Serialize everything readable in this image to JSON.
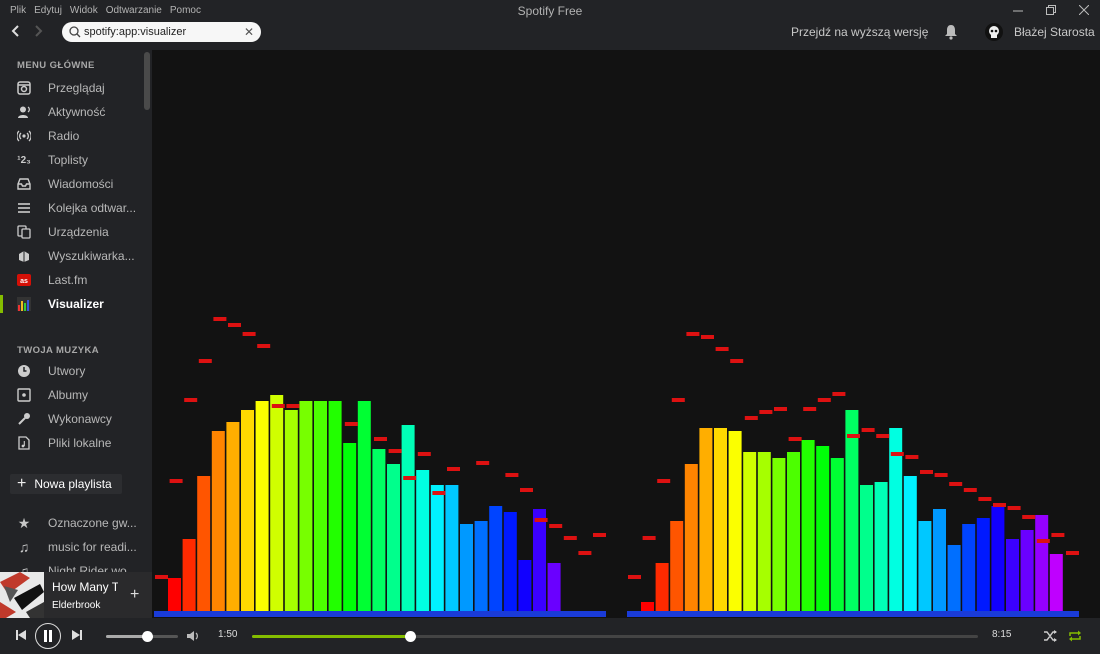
{
  "window": {
    "title": "Spotify Free",
    "menu": [
      "Plik",
      "Edytuj",
      "Widok",
      "Odtwarzanie",
      "Pomoc"
    ]
  },
  "header": {
    "search_value": "spotify:app:visualizer",
    "upgrade_label": "Przejdź na wyższą wersję",
    "username": "Błażej Starosta"
  },
  "sidebar": {
    "main_heading": "MENU GŁÓWNE",
    "main_items": [
      {
        "label": "Przeglądaj",
        "icon": "browse-icon"
      },
      {
        "label": "Aktywność",
        "icon": "activity-icon"
      },
      {
        "label": "Radio",
        "icon": "radio-icon"
      },
      {
        "label": "Toplisty",
        "icon": "charts-icon"
      },
      {
        "label": "Wiadomości",
        "icon": "inbox-icon"
      },
      {
        "label": "Kolejka odtwar...",
        "icon": "queue-icon"
      },
      {
        "label": "Urządzenia",
        "icon": "devices-icon"
      },
      {
        "label": "Wyszukiwarka...",
        "icon": "app-finder-icon"
      },
      {
        "label": "Last.fm",
        "icon": "lastfm-icon"
      },
      {
        "label": "Visualizer",
        "icon": "visualizer-icon",
        "active": true
      }
    ],
    "music_heading": "TWOJA MUZYKA",
    "music_items": [
      {
        "label": "Utwory",
        "icon": "songs-icon"
      },
      {
        "label": "Albumy",
        "icon": "albums-icon"
      },
      {
        "label": "Wykonawcy",
        "icon": "artists-icon"
      },
      {
        "label": "Pliki lokalne",
        "icon": "local-files-icon"
      }
    ],
    "new_playlist_label": "Nowa playlista",
    "playlists": [
      {
        "label": "Oznaczone gw...",
        "icon": "star-icon"
      },
      {
        "label": "music for readi...",
        "icon": "note-icon"
      },
      {
        "label": "Night Rider wo...",
        "icon": "note-icon"
      }
    ]
  },
  "now_playing": {
    "title": "How Many Ti",
    "artist": "Elderbrook"
  },
  "player": {
    "current_time": "1:50",
    "total_time": "8:15",
    "progress": 0.218,
    "volume": 0.58,
    "accent": "#84bd00"
  },
  "visualizer": {
    "max_level": 100,
    "baseline_color": "#1a3bd8",
    "peak_color": "#dd1111",
    "channels": [
      {
        "levels": [
          11,
          24,
          45,
          60,
          63,
          67,
          70,
          72,
          67,
          70,
          70,
          70,
          56,
          70,
          54,
          49,
          62,
          47,
          42,
          42,
          29,
          30,
          35,
          33,
          17,
          34,
          16
        ],
        "peaks": [
          12,
          44,
          71,
          84,
          98,
          96,
          93,
          89,
          69,
          69,
          null,
          null,
          null,
          63,
          null,
          58,
          54,
          45,
          53,
          40,
          48,
          null,
          50,
          null,
          46,
          41,
          31,
          29,
          25,
          20,
          26
        ]
      },
      {
        "levels": [
          3,
          16,
          30,
          49,
          61,
          61,
          60,
          53,
          53,
          51,
          53,
          57,
          55,
          51,
          67,
          42,
          43,
          61,
          45,
          30,
          34,
          22,
          29,
          31,
          35,
          24,
          27,
          32,
          19
        ],
        "peaks": [
          12,
          25,
          44,
          71,
          93,
          92,
          88,
          84,
          65,
          67,
          68,
          58,
          68,
          71,
          73,
          59,
          61,
          59,
          53,
          52,
          47,
          46,
          43,
          41,
          38,
          36,
          35,
          32,
          24,
          26,
          20
        ]
      }
    ]
  }
}
